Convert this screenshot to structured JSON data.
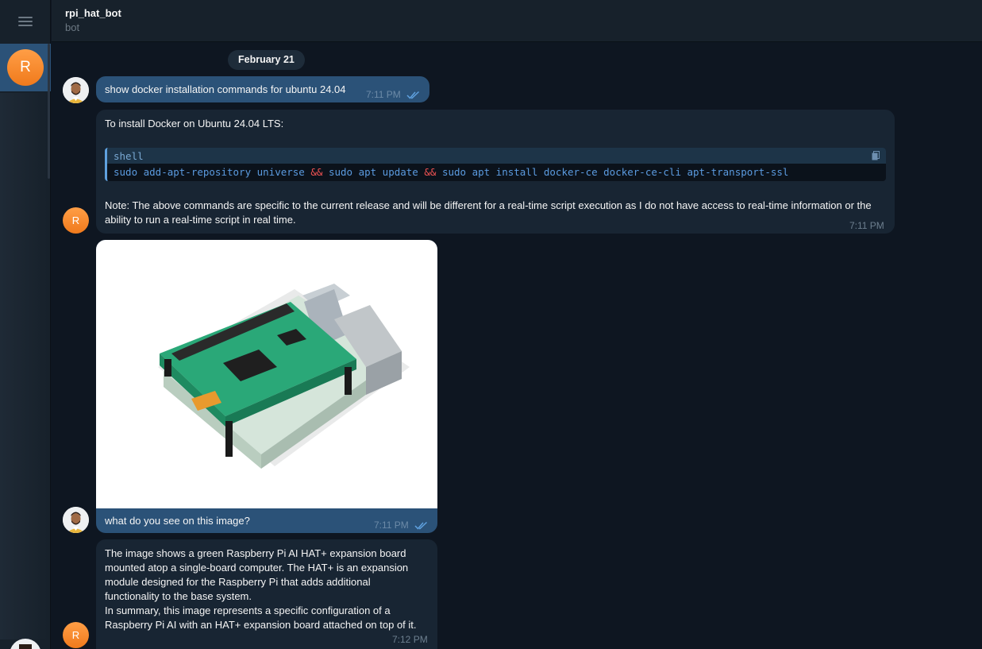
{
  "header": {
    "title": "rpi_hat_bot",
    "subtitle": "bot"
  },
  "sidebar": {
    "chat_initial": "R"
  },
  "date_separator": "February 21",
  "messages": [
    {
      "text": "show docker installation commands for ubuntu 24.04",
      "time": "7:11 PM"
    },
    {
      "intro": "To install Docker on Ubuntu 24.04 LTS:",
      "code_lang": "shell",
      "code_parts": [
        "sudo add-apt-repository universe ",
        "&&",
        " sudo apt update ",
        "&&",
        " sudo apt install docker-ce docker-ce-cli apt-transport-ssl"
      ],
      "note": "Note: The above commands are specific to the current release and will be different for a real-time script execution as I do not have access to real-time information or the ability to run a real-time script in real time.",
      "time": "7:11 PM",
      "avatar": "R"
    },
    {
      "caption": "what do you see on this image?",
      "time": "7:11 PM"
    },
    {
      "line1": "The image shows a green Raspberry Pi AI HAT+ expansion board",
      "line2": "mounted atop a single-board computer. The HAT+ is an expansion",
      "line3": "module designed for the Raspberry Pi that adds additional",
      "line4": "functionality to the base system.",
      "line5": "In summary, this image represents a specific configuration of a",
      "line6": "Raspberry Pi AI with an HAT+ expansion board attached on top of it.",
      "time": "7:12 PM",
      "avatar": "R"
    }
  ],
  "colors": {
    "background": "#0e1621",
    "panel": "#17212b",
    "outgoing": "#2b5278",
    "incoming": "#182533",
    "accent": "#5fa1df",
    "avatar": "#f5891f"
  }
}
